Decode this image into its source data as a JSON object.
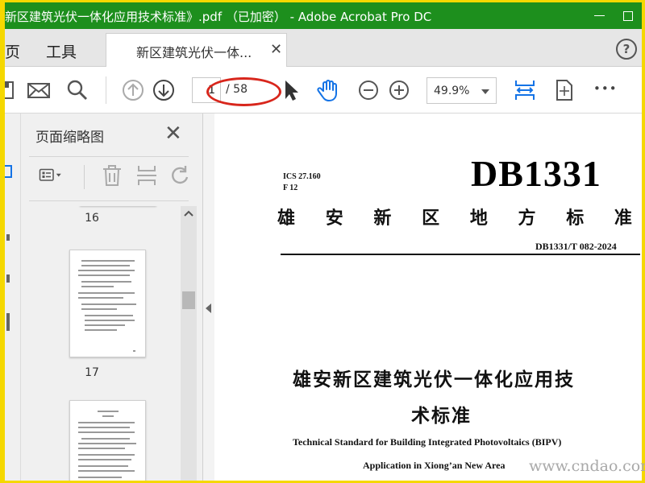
{
  "window": {
    "title": "新区建筑光伏一体化应用技术标准》.pdf （已加密） - Adobe Acrobat Pro DC",
    "title_bar_color": "#1d8f1d",
    "frame_color": "#f5d800"
  },
  "menu": {
    "home_label": "页",
    "tools_label": "工具",
    "tab_label": "新区建筑光伏一体...",
    "help_icon": "?"
  },
  "toolbar": {
    "current_page": "1",
    "total_pages": "/ 58",
    "zoom_value": "49.9%",
    "more_icon": "•••",
    "icons": [
      "save-icon",
      "mail-icon",
      "search-icon",
      "page-up-icon",
      "page-down-icon",
      "select-cursor-icon",
      "hand-tool-icon",
      "zoom-out-icon",
      "zoom-in-icon",
      "fit-width-icon",
      "rotate-page-icon",
      "more-icon"
    ]
  },
  "thumbnails_panel": {
    "title": "页面缩略图",
    "close_icon": "✕",
    "page_numbers": [
      "16",
      "17"
    ]
  },
  "document": {
    "ics": "ICS 27.160",
    "f_code": "F 12",
    "code": "DB1331",
    "standard_title_chars": [
      "雄",
      "安",
      "新",
      "区",
      "地",
      "方",
      "标",
      "准"
    ],
    "standard_number": "DB1331/T 082-2024",
    "cn_title_line1": "雄安新区建筑光伏一体化应用技",
    "cn_title_line2": "术标准",
    "en_title_line1": "Technical Standard for Building Integrated Photovoltaics (BIPV)",
    "en_title_line2": "Application in Xiong’an New Area"
  },
  "watermark": "www.cndao.com"
}
